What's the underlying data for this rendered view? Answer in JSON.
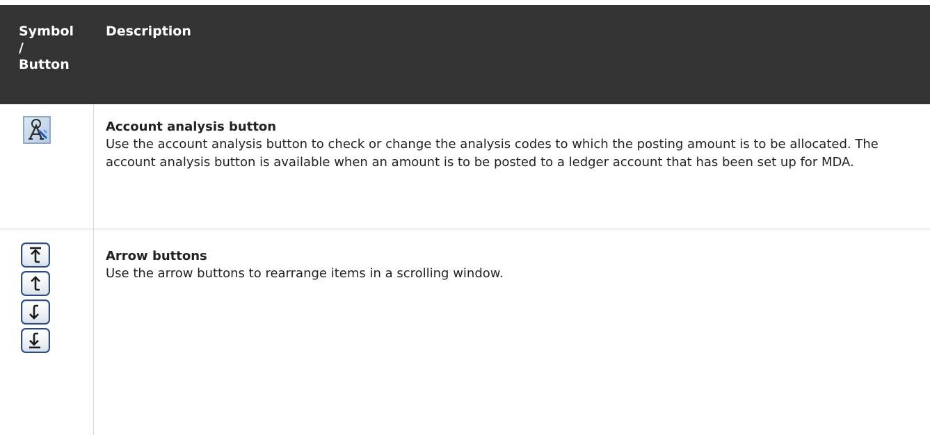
{
  "header": {
    "col1_line1": "Symbol",
    "col1_line2": "/",
    "col1_line3": "Button",
    "col2": "Description"
  },
  "rows": [
    {
      "icon": "account-analysis-icon",
      "title": "Account analysis button",
      "description": "Use the account analysis button to check or change the analysis codes to which the posting amount is to be allocated. The account analysis button is available when an amount is to be posted to a ledger account that has been set up for MDA."
    },
    {
      "icon": "arrow-buttons-icon",
      "title": "Arrow buttons",
      "description": "Use the arrow buttons to rearrange items in a scrolling window."
    }
  ],
  "colors": {
    "header_bg": "#333333",
    "header_text": "#ffffff",
    "body_text": "#222222",
    "divider": "#d6d6d6",
    "button_border": "#2e4b7a"
  }
}
